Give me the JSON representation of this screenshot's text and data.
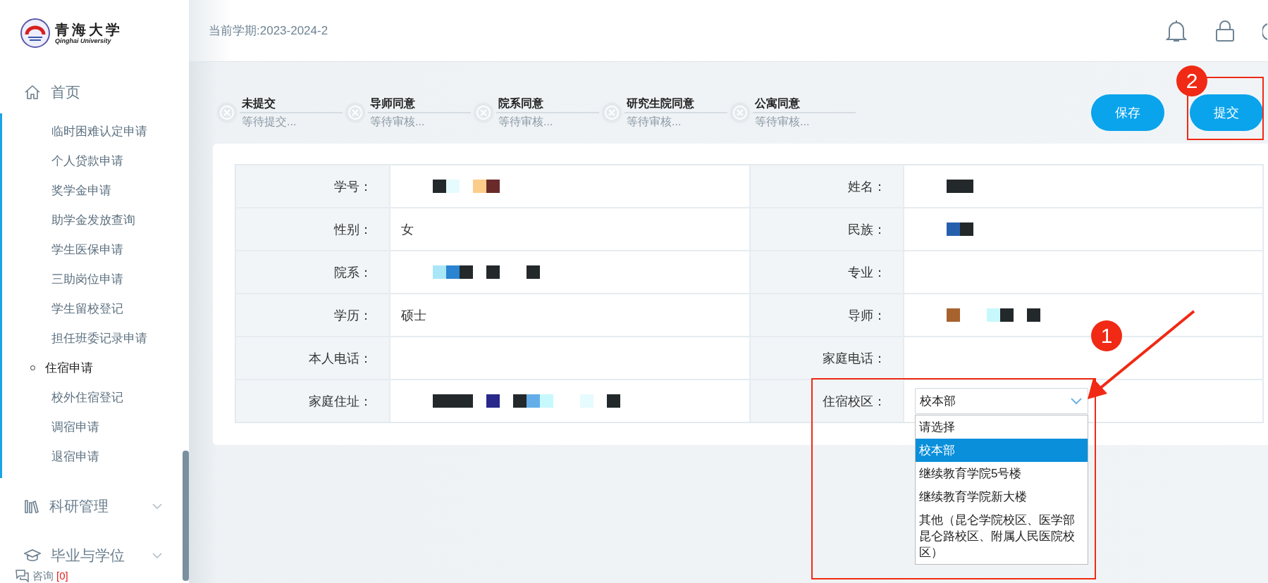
{
  "sidebar": {
    "logo": {
      "title": "青海大学",
      "subtitle": "Qinghai University"
    },
    "home": {
      "label": "首页"
    },
    "submenu": [
      {
        "label": "临时困难认定申请",
        "selected": false
      },
      {
        "label": "个人贷款申请",
        "selected": false
      },
      {
        "label": "奖学金申请",
        "selected": false
      },
      {
        "label": "助学金发放查询",
        "selected": false
      },
      {
        "label": "学生医保申请",
        "selected": false
      },
      {
        "label": "三助岗位申请",
        "selected": false
      },
      {
        "label": "学生留校登记",
        "selected": false
      },
      {
        "label": "担任班委记录申请",
        "selected": false
      },
      {
        "label": "住宿申请",
        "selected": true
      },
      {
        "label": "校外住宿登记",
        "selected": false
      },
      {
        "label": "调宿申请",
        "selected": false
      },
      {
        "label": "退宿申请",
        "selected": false
      }
    ],
    "groups": [
      {
        "label": "科研管理",
        "expanded": false
      },
      {
        "label": "毕业与学位",
        "expanded": false
      }
    ],
    "consult": {
      "label": "咨询",
      "count": "[0]"
    }
  },
  "header": {
    "term": "当前学期:2023-2024-2"
  },
  "steps": [
    {
      "title": "未提交",
      "subtitle": "等待提交...",
      "done": false
    },
    {
      "title": "导师同意",
      "subtitle": "等待审核...",
      "done": false
    },
    {
      "title": "院系同意",
      "subtitle": "等待审核...",
      "done": false
    },
    {
      "title": "研究生院同意",
      "subtitle": "等待审核...",
      "done": false
    },
    {
      "title": "公寓同意",
      "subtitle": "等待审核...",
      "done": false
    }
  ],
  "buttons": [
    {
      "label": "保存"
    },
    {
      "label": "提交"
    }
  ],
  "form": {
    "rows": [
      [
        {
          "label": "学号：",
          "redacted": true
        },
        {
          "label": "姓名：",
          "redacted": true
        }
      ],
      [
        {
          "label": "性别：",
          "value": "女"
        },
        {
          "label": "民族：",
          "redacted": true
        }
      ],
      [
        {
          "label": "院系：",
          "redacted": true
        },
        {
          "label": "专业："
        }
      ],
      [
        {
          "label": "学历：",
          "value": "硕士"
        },
        {
          "label": "导师：",
          "redacted": true
        }
      ],
      [
        {
          "label": "本人电话："
        },
        {
          "label": "家庭电话："
        }
      ],
      [
        {
          "label": "家庭住址：",
          "redacted": true
        },
        {
          "label": "住宿校区：",
          "kind": "select"
        }
      ]
    ],
    "campus_select": {
      "value": "校本部",
      "open": true,
      "options": [
        {
          "label": "请选择",
          "selected": false
        },
        {
          "label": "校本部",
          "selected": true
        },
        {
          "label": "继续教育学院5号楼",
          "selected": false
        },
        {
          "label": "继续教育学院新大楼",
          "selected": false
        },
        {
          "label": "其他（昆仑学院校区、医学部昆仑路校区、附属人民医院校区）",
          "selected": false
        }
      ]
    }
  },
  "annotations": [
    {
      "label": "1"
    },
    {
      "label": "2"
    }
  ]
}
